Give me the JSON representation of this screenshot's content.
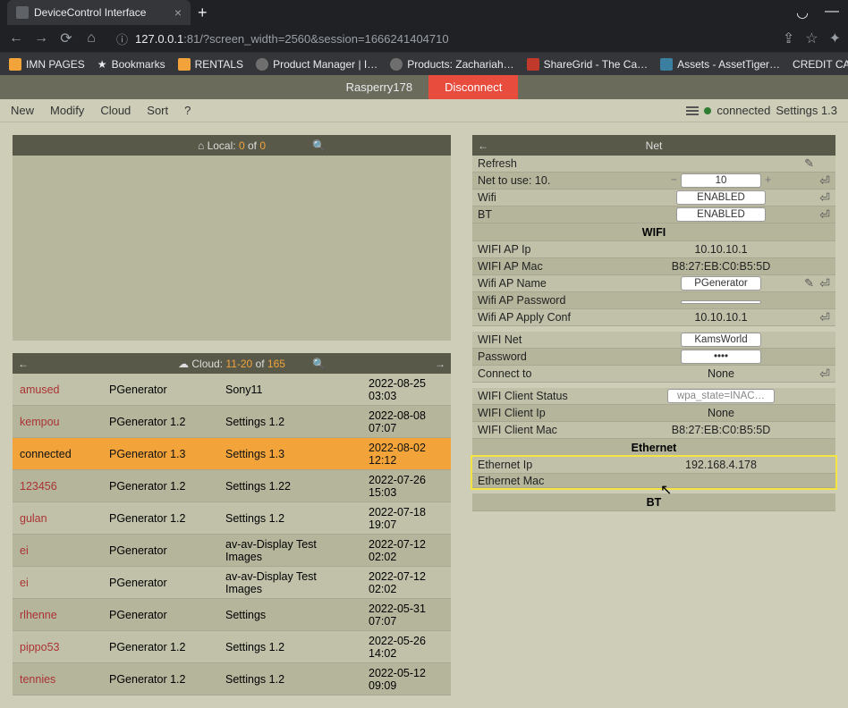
{
  "browser": {
    "tab_title": "DeviceControl Interface",
    "url_prefix": "127.0.0.1",
    "url_rest": ":81/?screen_width=2560&session=1666241404710",
    "bookmarks": [
      "IMN PAGES",
      "Bookmarks",
      "RENTALS",
      "Product Manager | I…",
      "Products: Zachariah…",
      "ShareGrid - The Ca…",
      "Assets - AssetTiger…",
      "CREDIT CARD FIRST…"
    ]
  },
  "app": {
    "device_name": "Rasperry178",
    "disconnect": "Disconnect",
    "menu": {
      "new": "New",
      "modify": "Modify",
      "cloud": "Cloud",
      "sort": "Sort",
      "help": "?"
    },
    "status_connected": "connected",
    "settings_version": "Settings 1.3"
  },
  "local": {
    "prefix": "Local:",
    "a": "0",
    "of": "of",
    "b": "0"
  },
  "cloud": {
    "prefix": "Cloud:",
    "range": "11-20",
    "of": "of",
    "total": "165",
    "rows": [
      {
        "name": "amused",
        "gen": "PGenerator",
        "set": "Sony11",
        "time": "2022-08-25 03:03"
      },
      {
        "name": "kempou",
        "gen": "PGenerator 1.2",
        "set": "Settings 1.2",
        "time": "2022-08-08 07:07"
      },
      {
        "name": "connected",
        "gen": "PGenerator 1.3",
        "set": "Settings 1.3",
        "time": "2022-08-02 12:12"
      },
      {
        "name": "123456",
        "gen": "PGenerator 1.2",
        "set": "Settings 1.22",
        "time": "2022-07-26 15:03"
      },
      {
        "name": "gulan",
        "gen": "PGenerator 1.2",
        "set": "Settings 1.2",
        "time": "2022-07-18 19:07"
      },
      {
        "name": "ei",
        "gen": "PGenerator",
        "set": "av-av-Display Test Images",
        "time": "2022-07-12 02:02"
      },
      {
        "name": "ei",
        "gen": "PGenerator",
        "set": "av-av-Display Test Images",
        "time": "2022-07-12 02:02"
      },
      {
        "name": "rlhenne",
        "gen": "PGenerator",
        "set": "Settings",
        "time": "2022-05-31 07:07"
      },
      {
        "name": "pippo53",
        "gen": "PGenerator 1.2",
        "set": "Settings 1.2",
        "time": "2022-05-26 14:02"
      },
      {
        "name": "tennies",
        "gen": "PGenerator 1.2",
        "set": "Settings 1.2",
        "time": "2022-05-12 09:09"
      }
    ]
  },
  "net": {
    "title": "Net",
    "refresh": "Refresh",
    "net_to_use": {
      "label": "Net to use: 10.",
      "value": "10"
    },
    "wifi": {
      "label": "Wifi",
      "value": "ENABLED"
    },
    "bt": {
      "label": "BT",
      "value": "ENABLED"
    },
    "section_wifi": "WIFI",
    "wifi_ap_ip": {
      "label": "WIFI AP Ip",
      "value": "10.10.10.1"
    },
    "wifi_ap_mac": {
      "label": "WIFI AP Mac",
      "value": "B8:27:EB:C0:B5:5D"
    },
    "wifi_ap_name": {
      "label": "Wifi AP Name",
      "value": "PGenerator"
    },
    "wifi_ap_password": {
      "label": "Wifi AP Password",
      "value": ""
    },
    "wifi_ap_apply": {
      "label": "Wifi AP Apply Conf",
      "value": "10.10.10.1"
    },
    "wifi_net": {
      "label": "WIFI Net",
      "value": "KamsWorld"
    },
    "password": {
      "label": "Password",
      "value": "••••"
    },
    "connect_to": {
      "label": "Connect to",
      "value": "None"
    },
    "wifi_client_status": {
      "label": "WIFI Client Status",
      "value": "wpa_state=INAC…"
    },
    "wifi_client_ip": {
      "label": "WIFI Client Ip",
      "value": "None"
    },
    "wifi_client_mac": {
      "label": "WIFI Client Mac",
      "value": "B8:27:EB:C0:B5:5D"
    },
    "section_eth": "Ethernet",
    "eth_ip": {
      "label": "Ethernet Ip",
      "value": "192.168.4.178"
    },
    "eth_mac": {
      "label": "Ethernet Mac",
      "value": ""
    },
    "section_bt": "BT"
  }
}
